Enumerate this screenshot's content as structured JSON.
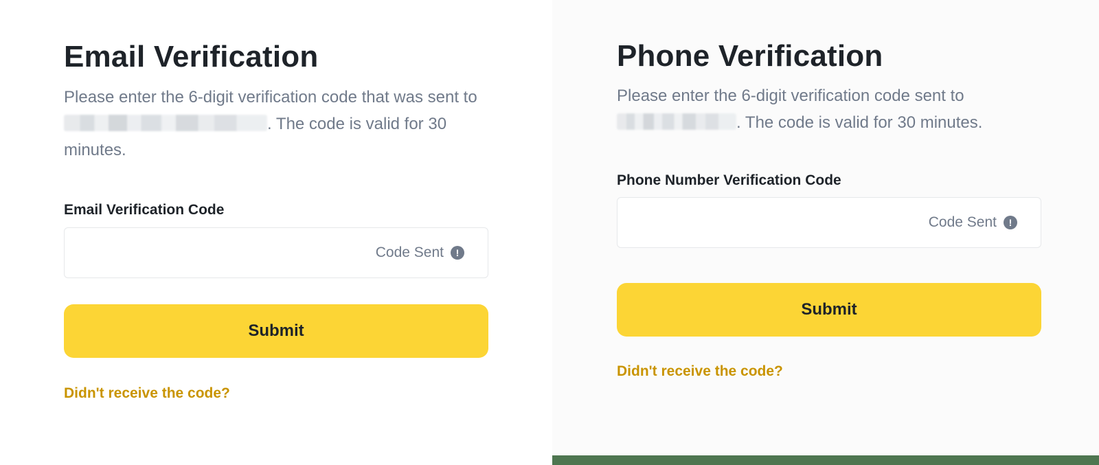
{
  "email_panel": {
    "title": "Email Verification",
    "description_before": "Please enter the 6-digit verification code that was sent to",
    "description_after": ". The code is valid for 30 minutes.",
    "field_label": "Email Verification Code",
    "input_value": "",
    "code_status": "Code Sent",
    "submit_label": "Submit",
    "resend_link": "Didn't receive the code?"
  },
  "phone_panel": {
    "title": "Phone Verification",
    "description_before": "Please enter the 6-digit verification code sent to",
    "description_after": ". The code is valid for 30 minutes.",
    "field_label": "Phone Number Verification Code",
    "input_value": "",
    "code_status": "Code Sent",
    "submit_label": "Submit",
    "resend_link": "Didn't receive the code?"
  },
  "icons": {
    "code_status_icon": "exclamation-circle-icon"
  },
  "colors": {
    "accent_yellow": "#fcd535",
    "link_gold": "#c99400",
    "text_dark": "#1e2329",
    "text_muted": "#707a8a",
    "strip_green": "#4e7650"
  }
}
